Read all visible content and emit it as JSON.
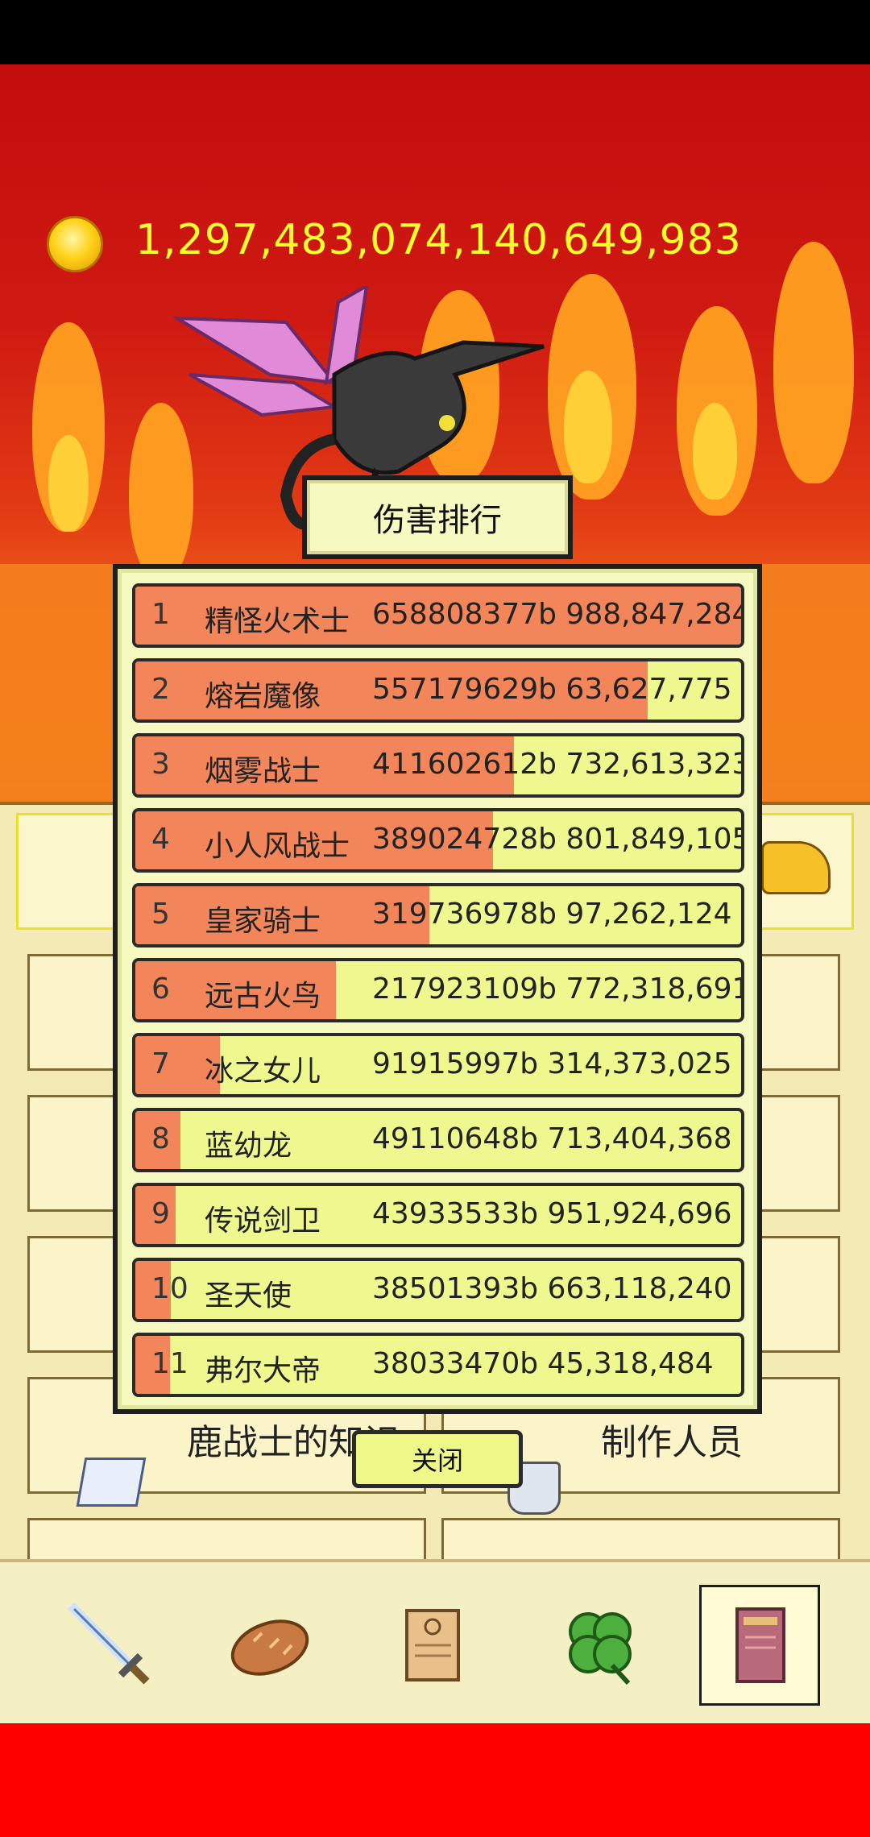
{
  "gold_amount": "1,297,483,074,140,649,983",
  "gold_icon": "gold-coin-icon",
  "dialog": {
    "title": "伤害排行",
    "close_label": "关闭",
    "rows": [
      {
        "rank": "1",
        "name": "精怪火术士",
        "damage": "658808377b 988,847,284",
        "bar_fraction": 1.0
      },
      {
        "rank": "2",
        "name": "熔岩魔像",
        "damage": "557179629b 63,627,775",
        "bar_fraction": 0.846
      },
      {
        "rank": "3",
        "name": "烟雾战士",
        "damage": "411602612b 732,613,323",
        "bar_fraction": 0.625
      },
      {
        "rank": "4",
        "name": "小人风战士",
        "damage": "389024728b 801,849,105",
        "bar_fraction": 0.59
      },
      {
        "rank": "5",
        "name": "皇家骑士",
        "damage": "319736978b 97,262,124",
        "bar_fraction": 0.485
      },
      {
        "rank": "6",
        "name": "远古火鸟",
        "damage": "217923109b 772,318,691",
        "bar_fraction": 0.331
      },
      {
        "rank": "7",
        "name": "冰之女儿",
        "damage": "91915997b 314,373,025",
        "bar_fraction": 0.14
      },
      {
        "rank": "8",
        "name": "蓝幼龙",
        "damage": "49110648b 713,404,368",
        "bar_fraction": 0.0745
      },
      {
        "rank": "9",
        "name": "传说剑卫",
        "damage": "43933533b 951,924,696",
        "bar_fraction": 0.0667
      },
      {
        "rank": "10",
        "name": "圣天使",
        "damage": "38501393b 663,118,240",
        "bar_fraction": 0.0584
      },
      {
        "rank": "11",
        "name": "弗尔大帝",
        "damage": "38033470b 45,318,484",
        "bar_fraction": 0.0577
      }
    ]
  },
  "menu": {
    "visible_left": "鹿战士的知识",
    "visible_right": "制作人员"
  },
  "navbar": {
    "items": [
      "sword-icon",
      "bread-icon",
      "scroll-icon",
      "clover-icon",
      "book-icon"
    ],
    "active": "book-icon"
  },
  "colors": {
    "bar_fill": "#f2855a",
    "row_bg": "#eef88e",
    "gold_text": "#ffff2a",
    "background": "#ff0000"
  }
}
